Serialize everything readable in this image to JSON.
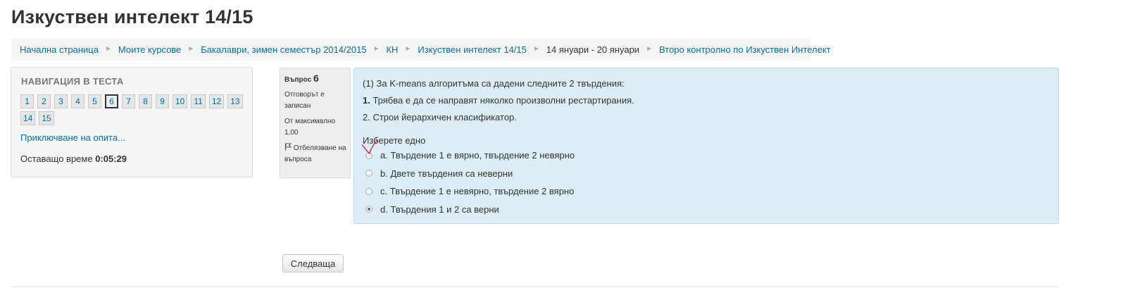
{
  "page": {
    "title": "Изкуствен интелект 14/15"
  },
  "breadcrumb": {
    "items": [
      {
        "label": "Начална страница",
        "link": true
      },
      {
        "label": "Моите курсове",
        "link": true
      },
      {
        "label": "Бакалаври, зимен семестър 2014/2015",
        "link": true
      },
      {
        "label": "КН",
        "link": true
      },
      {
        "label": "Изкуствен интелект 14/15",
        "link": true
      },
      {
        "label": "14 януари - 20 януари",
        "link": false
      },
      {
        "label": "Второ контролно по Изкуствен Интелект",
        "link": true
      }
    ],
    "separator": "►"
  },
  "quiz_nav": {
    "heading": "НАВИГАЦИЯ В ТЕСТА",
    "questions": [
      "1",
      "2",
      "3",
      "4",
      "5",
      "6",
      "7",
      "8",
      "9",
      "10",
      "11",
      "12",
      "13",
      "14",
      "15"
    ],
    "current": "6",
    "finish_label": "Приключване на опита...",
    "timer_label": "Оставащо време",
    "timer_value": "0:05:29"
  },
  "question_info": {
    "label": "Въпрос",
    "number": "6",
    "state": "Отговорът е записан",
    "grade": "От максимално 1,00",
    "flag_label": "Отбелязване на въпроса",
    "flag_icon": "flag-icon"
  },
  "question": {
    "text_line1": "(1) За K-means алгоритъма са дадени следните 2 твърдения:",
    "text_line2_num": "1.",
    "text_line2": " Трябва е да се направят няколко произволни рестартирания.",
    "text_line3": "2. Строи йерархичен класификатор.",
    "prompt": "Изберете едно",
    "answers": [
      {
        "label": "a. Твърдение 1 е вярно, твърдение 2 невярно",
        "checked": false
      },
      {
        "label": "b. Двете твърдения са неверни",
        "checked": false
      },
      {
        "label": "c. Твърдение 1 е невярно, твърдение 2 вярно",
        "checked": false
      },
      {
        "label": "d. Твърдения 1 и 2 са верни",
        "checked": true
      }
    ],
    "annotation_color": "#d9001b"
  },
  "footer": {
    "next_label": "Следваща"
  }
}
